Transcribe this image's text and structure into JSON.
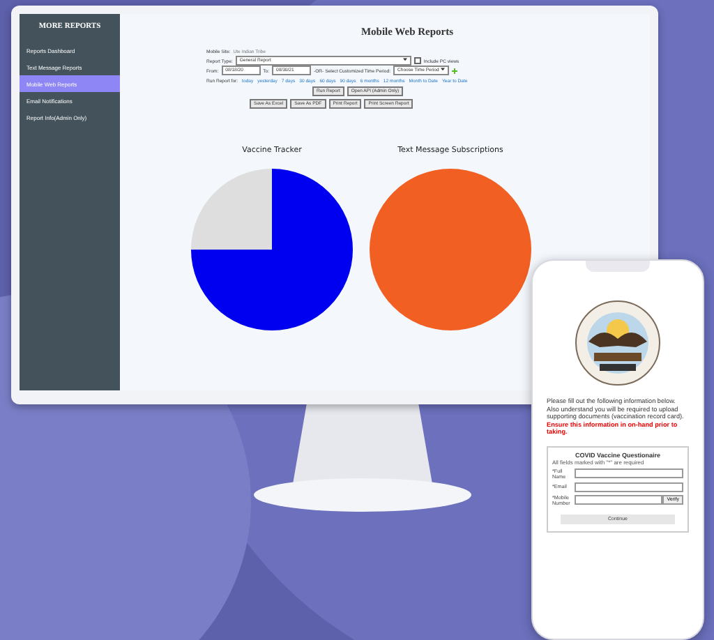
{
  "sidebar": {
    "title": "MORE REPORTS",
    "items": [
      {
        "label": "Reports Dashboard",
        "selected": false
      },
      {
        "label": "Text Message Reports",
        "selected": false
      },
      {
        "label": "Mobile Web Reports",
        "selected": true
      },
      {
        "label": "Email Notifications",
        "selected": false
      },
      {
        "label": "Report Info(Admin Only)",
        "selected": false
      }
    ]
  },
  "reports": {
    "title": "Mobile Web Reports",
    "site_label": "Mobile Site:",
    "site_name": "Ute Indian Tribe",
    "report_type_label": "Report Type:",
    "report_type_value": "General Report",
    "include_pc": {
      "label": "Include PC views",
      "checked": false
    },
    "from_label": "From:",
    "from_value": "08/18/20",
    "to_label": "To:",
    "to_value": "08/30/21",
    "period_label": "-OR- Select Customized Time Period:",
    "period_value": "Choose Time Period",
    "run_for_label": "Run Report for:",
    "ranges": [
      "today",
      "yesterday",
      "7 days",
      "30 days",
      "60 days",
      "90 days",
      "6 months",
      "12 months",
      "Month to Date",
      "Year to Date"
    ],
    "buttons_row1": [
      "Run Report",
      "Open API (Admin Only)"
    ],
    "buttons_row2": [
      "Save As Excel",
      "Save As PDF",
      "Print Report",
      "Print Screen Report"
    ]
  },
  "charts": [
    {
      "title": "Vaccine Tracker",
      "kind": "two-slice"
    },
    {
      "title": "Text Message Subscriptions",
      "kind": "single"
    }
  ],
  "phone": {
    "intro": "Please fill out the following information below. Also understand you will be required to upload supporting documents (vaccination record card). **Ensure this information in on-hand prior to taking.**",
    "form_title": "COVID Vaccine Questionaire",
    "form_note": "All fields marked with \"*\" are required",
    "fields": [
      {
        "label": "*Full Name",
        "kind": "text"
      },
      {
        "label": "*Email",
        "kind": "text"
      },
      {
        "label": "*Mobile Number",
        "kind": "verify",
        "button": "Verify"
      }
    ],
    "continue": "Continue"
  }
}
